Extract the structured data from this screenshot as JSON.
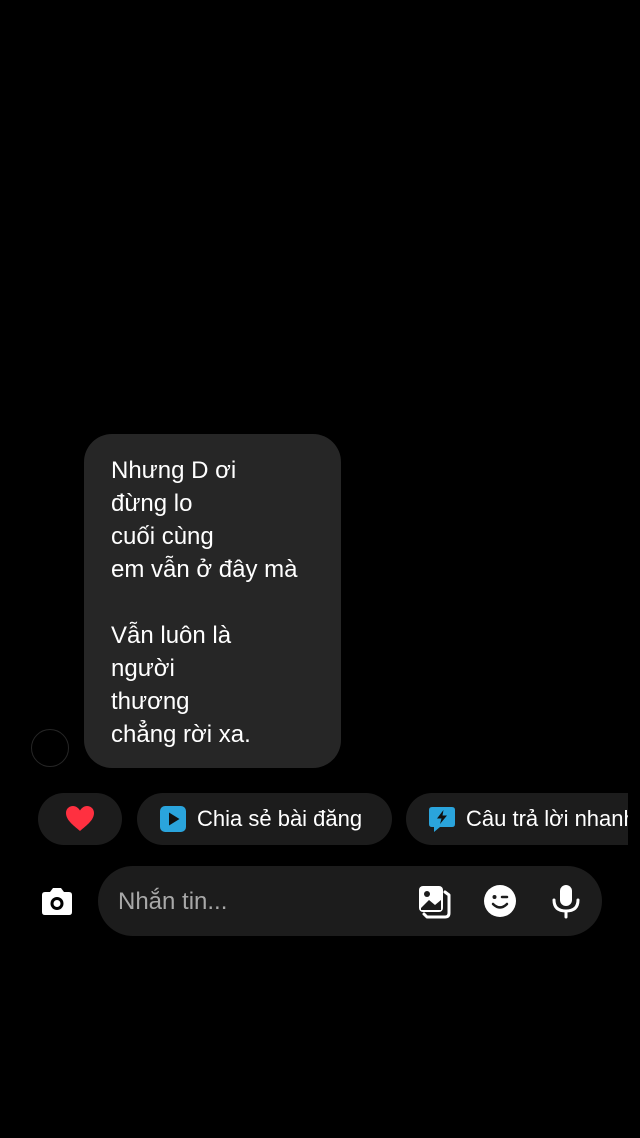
{
  "message": {
    "lines": [
      "Nhưng D ơi",
      "đừng lo",
      "cuối cùng",
      "em vẫn ở đây mà",
      "",
      "Vẫn luôn là",
      "người",
      "thương",
      "chẳng rời xa."
    ]
  },
  "quick_actions": {
    "heart_icon": "heart-icon",
    "share_label": "Chia sẻ bài đăng",
    "share_icon": "play-icon",
    "quick_reply_label": "Câu trả lời nhanh",
    "quick_reply_icon": "bolt-speech-icon"
  },
  "composer": {
    "placeholder": "Nhắn tin...",
    "camera_icon": "camera-icon",
    "gallery_icon": "gallery-icon",
    "sticker_icon": "sticker-icon",
    "mic_icon": "microphone-icon"
  },
  "colors": {
    "background": "#000000",
    "bubble": "#262626",
    "chip": "#1c1c1c",
    "heart": "#ff3040",
    "accent_blue": "#2aa4dc"
  }
}
